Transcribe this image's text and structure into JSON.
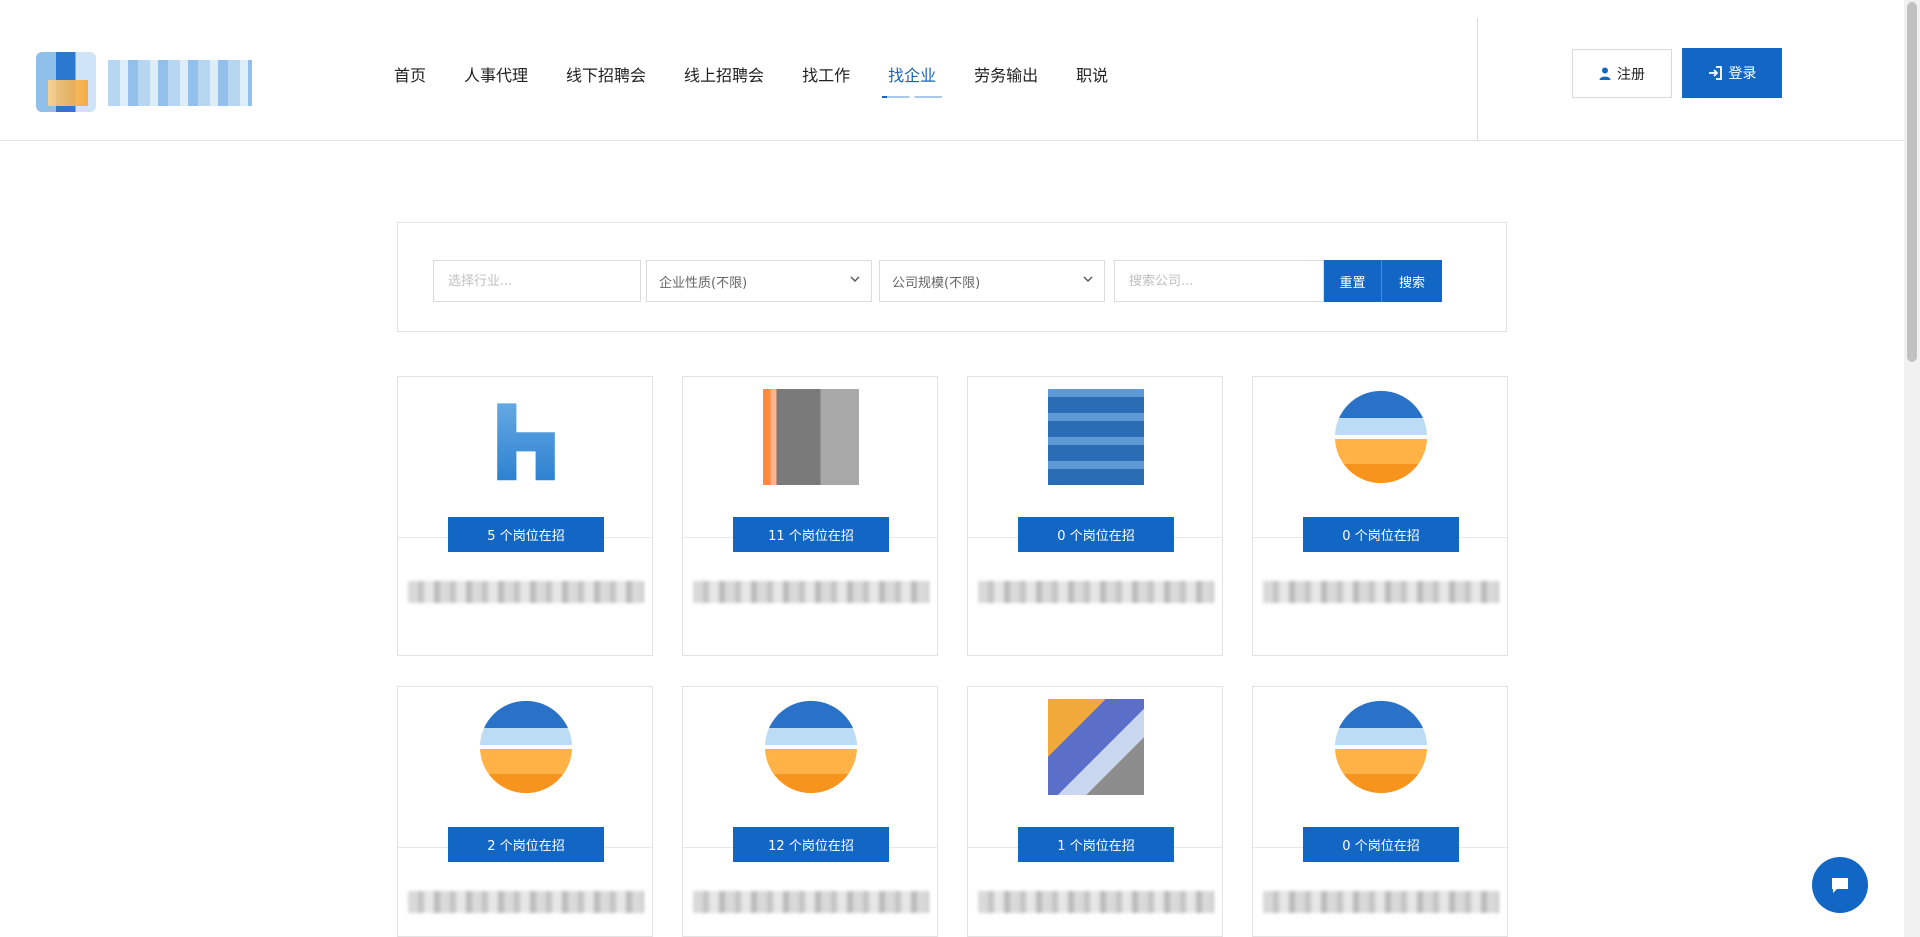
{
  "nav": {
    "items": [
      {
        "label": "首页",
        "active": false
      },
      {
        "label": "人事代理",
        "active": false
      },
      {
        "label": "线下招聘会",
        "active": false
      },
      {
        "label": "线上招聘会",
        "active": false
      },
      {
        "label": "找工作",
        "active": false
      },
      {
        "label": "找企业",
        "active": true
      },
      {
        "label": "劳务输出",
        "active": false
      },
      {
        "label": "职说",
        "active": false
      }
    ]
  },
  "auth": {
    "register_label": "注册",
    "login_label": "登录"
  },
  "search": {
    "industry_placeholder": "选择行业...",
    "nature_value": "企业性质(不限)",
    "scale_value": "公司规模(不限)",
    "company_placeholder": "搜索公司...",
    "reset_label": "重置",
    "search_label": "搜索"
  },
  "companies": [
    {
      "jobs_label": "5 个岗位在招",
      "logo": "logo-a"
    },
    {
      "jobs_label": "11 个岗位在招",
      "logo": "logo-b"
    },
    {
      "jobs_label": "0 个岗位在招",
      "logo": "logo-c"
    },
    {
      "jobs_label": "0 个岗位在招",
      "logo": "logo-s"
    },
    {
      "jobs_label": "2 个岗位在招",
      "logo": "logo-s"
    },
    {
      "jobs_label": "12 个岗位在招",
      "logo": "logo-s"
    },
    {
      "jobs_label": "1 个岗位在招",
      "logo": "logo-d"
    },
    {
      "jobs_label": "0 个岗位在招",
      "logo": "logo-s"
    }
  ],
  "colors": {
    "primary": "#1367c4",
    "active_nav": "#1a63b8"
  },
  "icons": {
    "register": "user-icon",
    "login": "sign-in-icon",
    "chat": "chat-icon",
    "select": "chevron-down-icon"
  }
}
